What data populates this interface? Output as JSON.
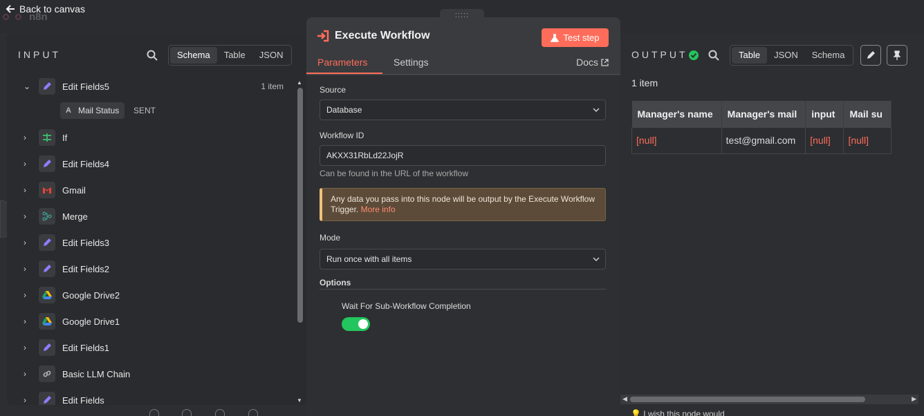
{
  "app": {
    "back_label": "Back to canvas",
    "logo_text": "n8n"
  },
  "input": {
    "title": "INPUT",
    "view_tabs": [
      "Schema",
      "Table",
      "JSON"
    ],
    "active_tab": "Schema",
    "expanded_node": {
      "name": "Edit Fields5",
      "count": "1 item",
      "field": {
        "type": "A",
        "name": "Mail Status",
        "value": "SENT"
      }
    },
    "nodes": [
      {
        "name": "If",
        "icon": "if-icon"
      },
      {
        "name": "Edit Fields4",
        "icon": "pencil-icon"
      },
      {
        "name": "Gmail",
        "icon": "gmail-icon"
      },
      {
        "name": "Merge",
        "icon": "merge-icon"
      },
      {
        "name": "Edit Fields3",
        "icon": "pencil-icon"
      },
      {
        "name": "Edit Fields2",
        "icon": "pencil-icon"
      },
      {
        "name": "Google Drive2",
        "icon": "google-drive-icon"
      },
      {
        "name": "Google Drive1",
        "icon": "google-drive-icon"
      },
      {
        "name": "Edit Fields1",
        "icon": "pencil-icon"
      },
      {
        "name": "Basic LLM Chain",
        "icon": "link-icon"
      },
      {
        "name": "Edit Fields",
        "icon": "pencil-icon"
      }
    ]
  },
  "node": {
    "title": "Execute Workflow",
    "test_label": "Test step",
    "tabs": [
      "Parameters",
      "Settings"
    ],
    "docs_label": "Docs",
    "params": {
      "source_label": "Source",
      "source_value": "Database",
      "workflow_id_label": "Workflow ID",
      "workflow_id_value": "AKXX31RbLd22JojR",
      "workflow_id_hint": "Can be found in the URL of the workflow",
      "notice_text": "Any data you pass into this node will be output by the Execute Workflow Trigger.",
      "notice_link": "More info",
      "mode_label": "Mode",
      "mode_value": "Run once with all items",
      "options_label": "Options",
      "wait_label": "Wait For Sub-Workflow Completion",
      "wait_enabled": true
    }
  },
  "output": {
    "title": "OUTPUT",
    "view_tabs": [
      "Table",
      "JSON",
      "Schema"
    ],
    "active_tab": "Table",
    "count": "1 item",
    "columns": [
      "Manager's name",
      "Manager's mail",
      "input",
      "Mail su"
    ],
    "rows": [
      [
        "[null]",
        "test@gmail.com",
        "[null]",
        "[null]"
      ]
    ],
    "wish_text": "I wish this node would"
  },
  "colors": {
    "accent": "#ff6d5a",
    "success": "#23c55e",
    "panel": "#2a2b2e"
  }
}
